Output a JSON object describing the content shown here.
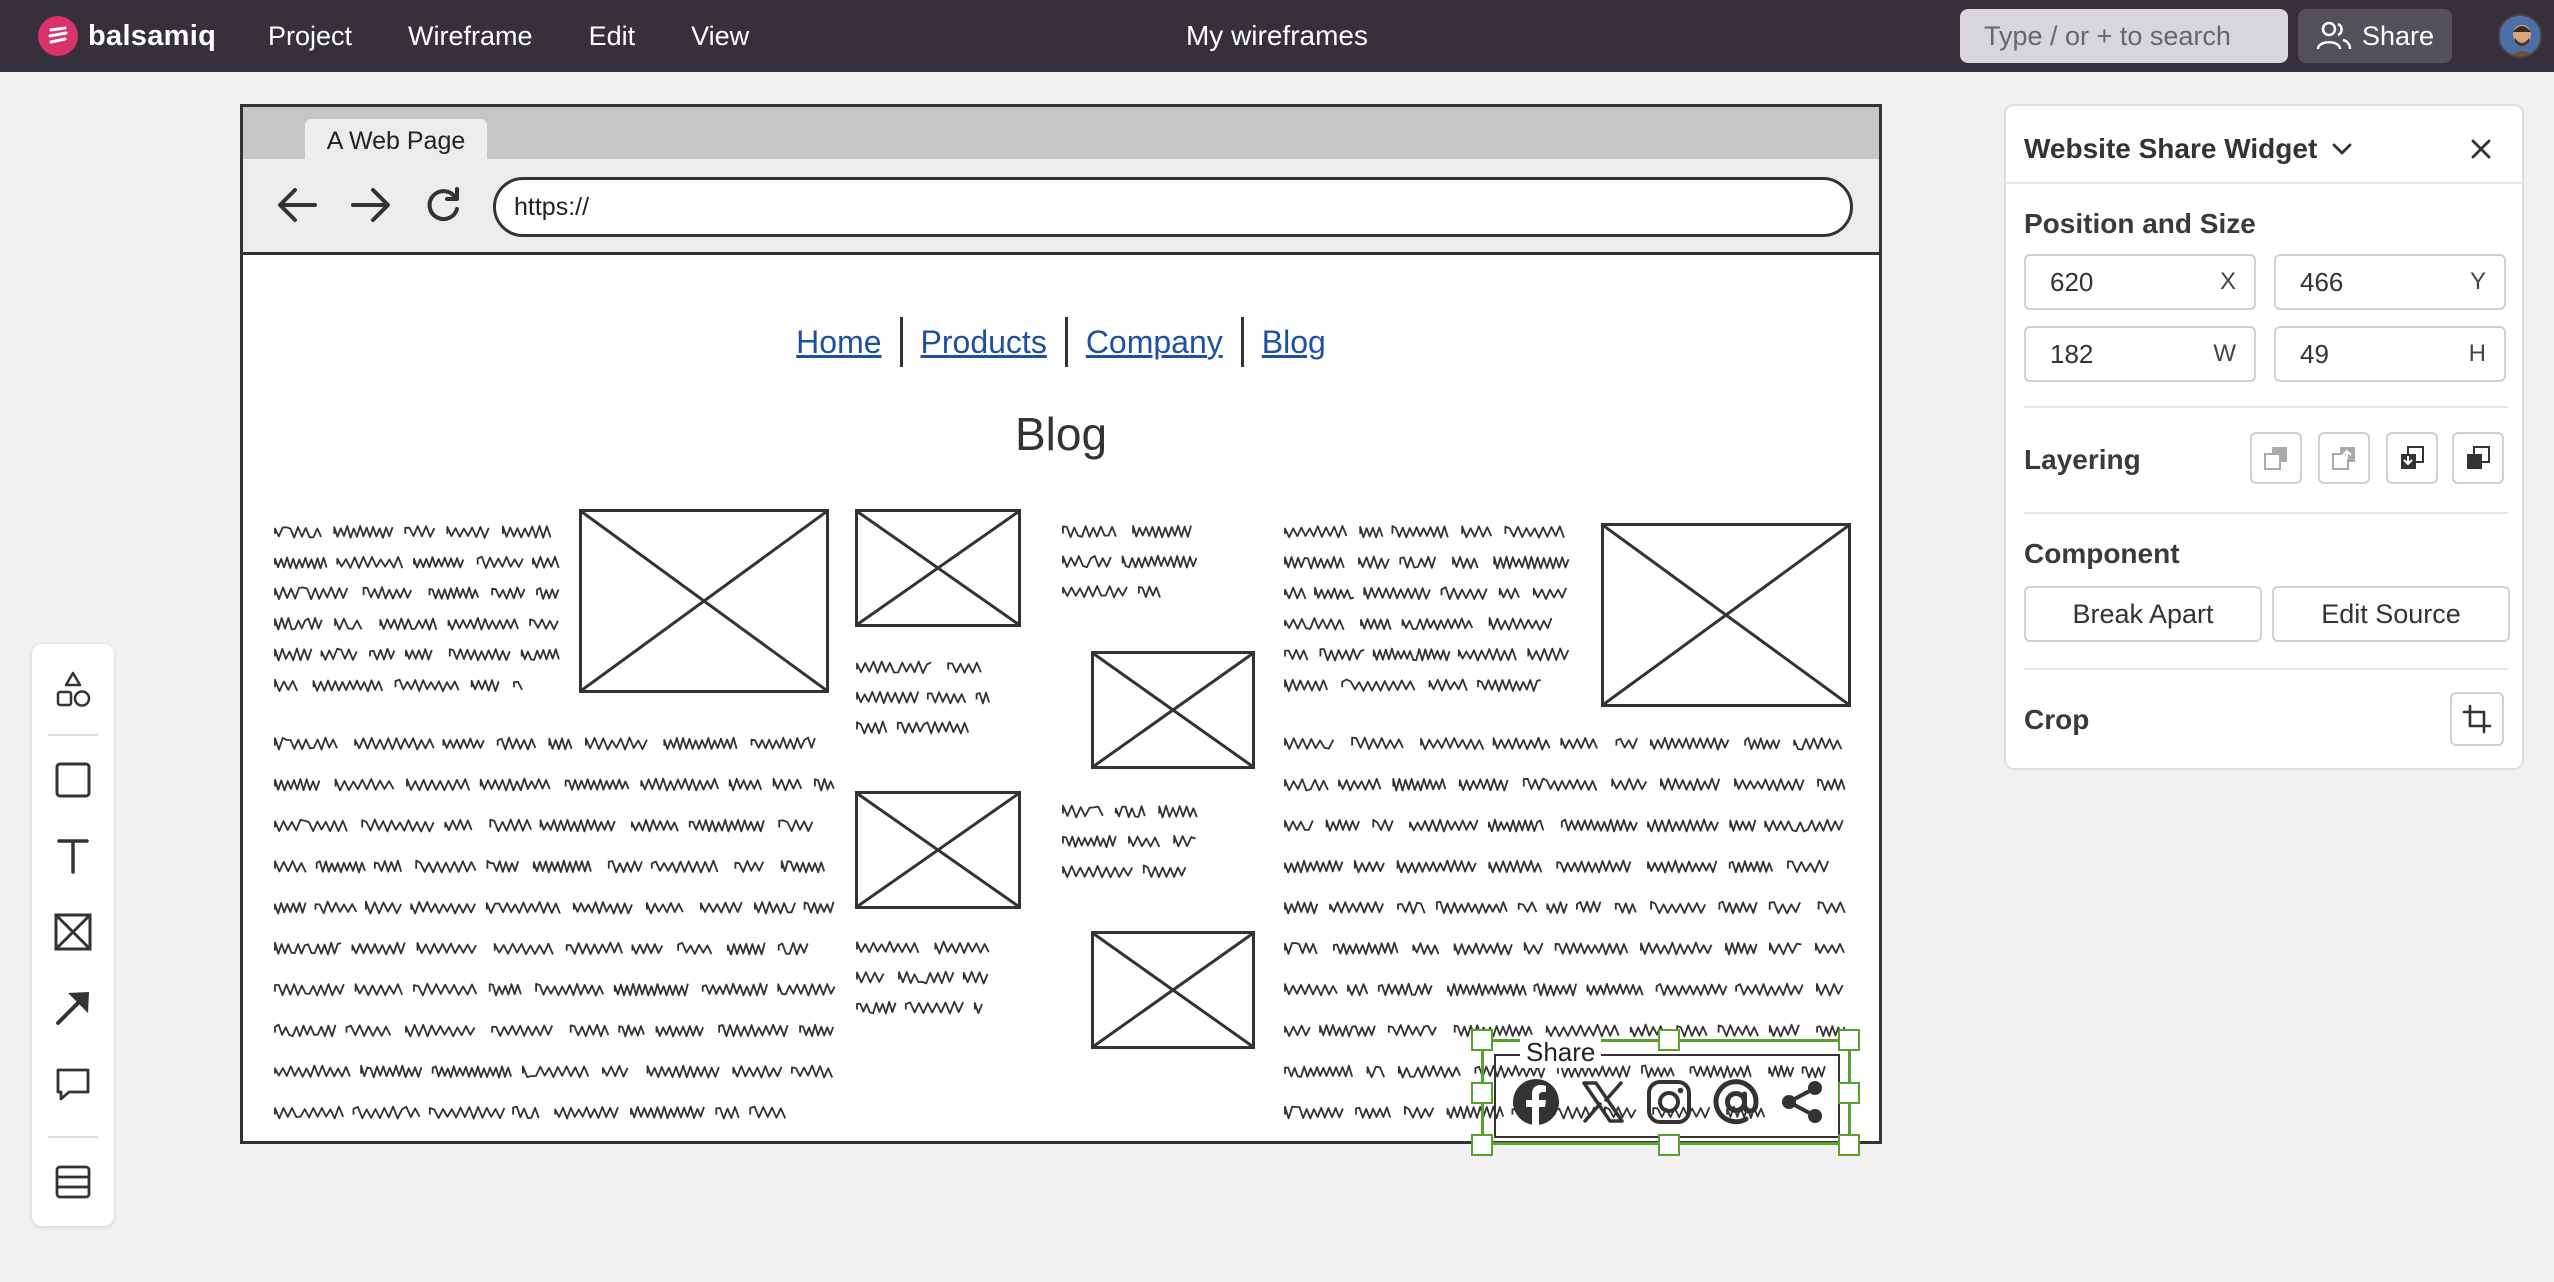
{
  "app": {
    "logo_text": "balsamiq",
    "menu": [
      "Project",
      "Wireframe",
      "Edit",
      "View"
    ],
    "document_title": "My wireframes",
    "search_placeholder": "Type / or + to search",
    "share_label": "Share"
  },
  "wireframe": {
    "tab_label": "A Web Page",
    "url": "https://",
    "nav_links": [
      "Home",
      "Products",
      "Company",
      "Blog"
    ],
    "heading": "Blog",
    "share_widget": {
      "legend": "Share",
      "icons": [
        "facebook-icon",
        "x-icon",
        "instagram-icon",
        "at-icon",
        "share-icon"
      ]
    }
  },
  "tools": [
    "shapes-icon",
    "rectangle-icon",
    "text-icon",
    "image-placeholder-icon",
    "arrow-icon",
    "comment-icon",
    "layers-icon"
  ],
  "panel": {
    "title": "Website Share Widget",
    "position_size_label": "Position and Size",
    "x_value": "620",
    "x_unit": "X",
    "y_value": "466",
    "y_unit": "Y",
    "w_value": "182",
    "w_unit": "W",
    "h_value": "49",
    "h_unit": "H",
    "layering_label": "Layering",
    "component_label": "Component",
    "break_apart_label": "Break Apart",
    "edit_source_label": "Edit Source",
    "crop_label": "Crop"
  },
  "colors": {
    "topbar": "#35303a",
    "brand": "#d9336b",
    "link": "#1f4fa0",
    "selection": "#5aa02c"
  }
}
